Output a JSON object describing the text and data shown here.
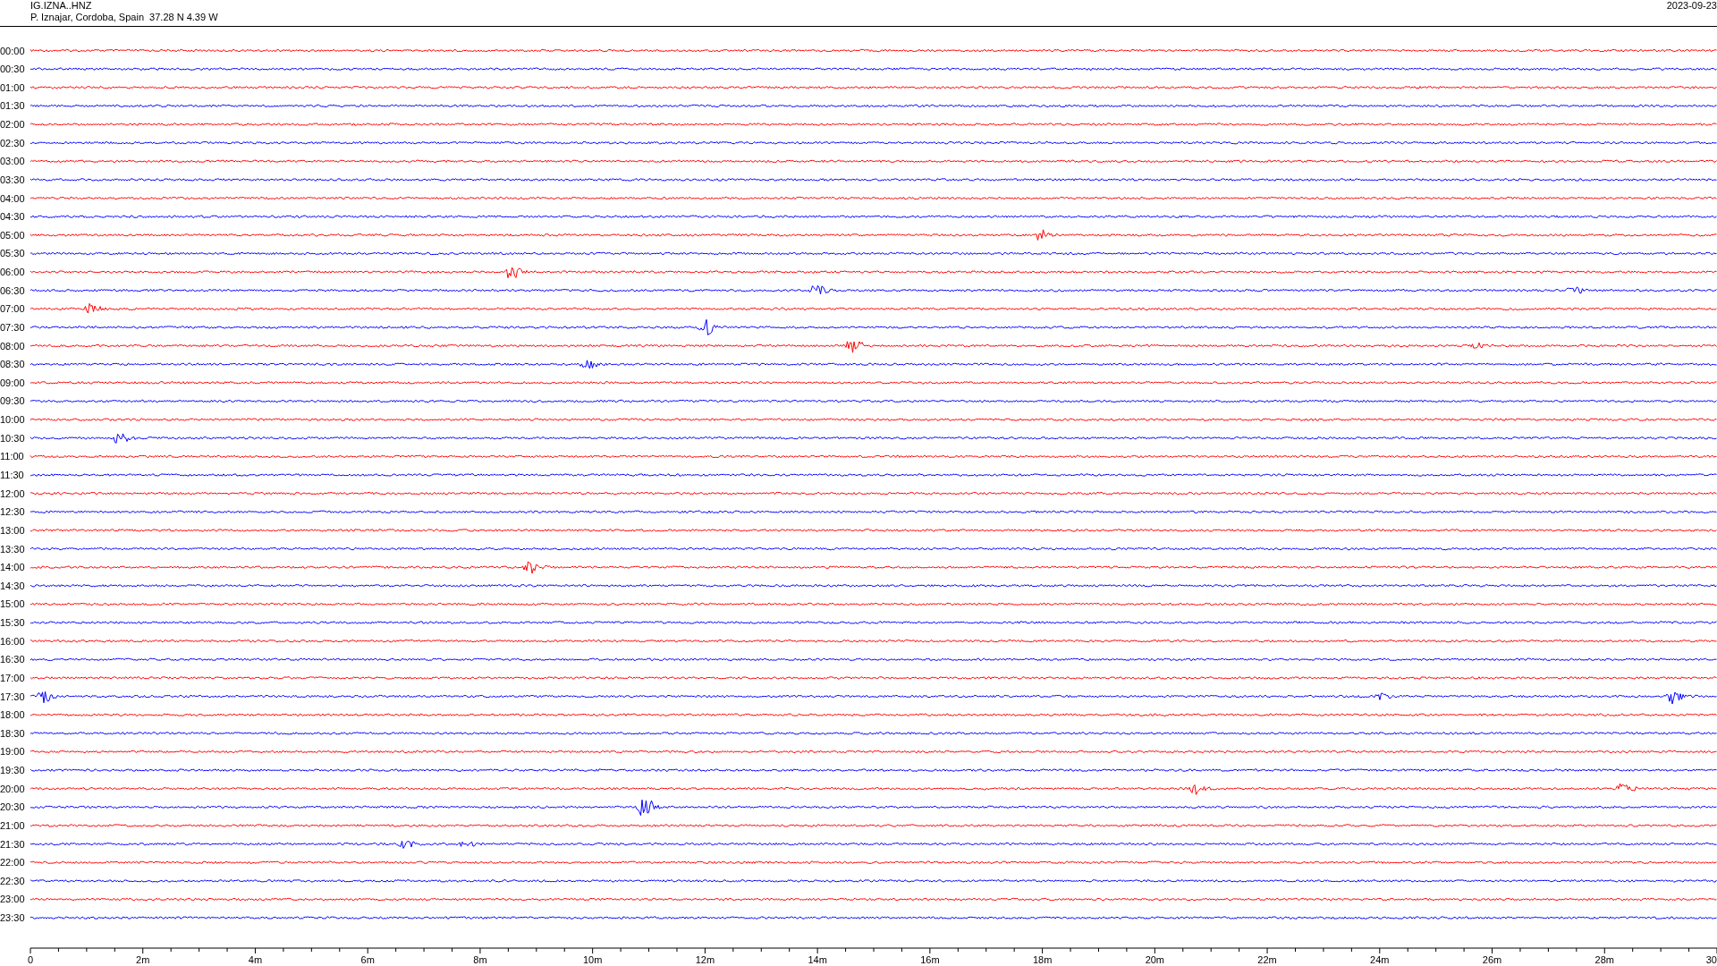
{
  "header": {
    "station": "IG.IZNA..HNZ",
    "location": "P. Iznajar, Cordoba, Spain  37.28 N 4.39 W",
    "date": "2023-09-23"
  },
  "traces": [
    {
      "label": "00:00",
      "color": "#ff0000"
    },
    {
      "label": "00:30",
      "color": "#0000ff"
    },
    {
      "label": "01:00",
      "color": "#ff0000"
    },
    {
      "label": "01:30",
      "color": "#0000ff"
    },
    {
      "label": "02:00",
      "color": "#ff0000"
    },
    {
      "label": "02:30",
      "color": "#0000ff"
    },
    {
      "label": "03:00",
      "color": "#ff0000"
    },
    {
      "label": "03:30",
      "color": "#0000ff"
    },
    {
      "label": "04:00",
      "color": "#ff0000"
    },
    {
      "label": "04:30",
      "color": "#0000ff"
    },
    {
      "label": "05:00",
      "color": "#ff0000"
    },
    {
      "label": "05:30",
      "color": "#0000ff"
    },
    {
      "label": "06:00",
      "color": "#ff0000"
    },
    {
      "label": "06:30",
      "color": "#0000ff"
    },
    {
      "label": "07:00",
      "color": "#ff0000"
    },
    {
      "label": "07:30",
      "color": "#0000ff"
    },
    {
      "label": "08:00",
      "color": "#ff0000"
    },
    {
      "label": "08:30",
      "color": "#0000ff"
    },
    {
      "label": "09:00",
      "color": "#ff0000"
    },
    {
      "label": "09:30",
      "color": "#0000ff"
    },
    {
      "label": "10:00",
      "color": "#ff0000"
    },
    {
      "label": "10:30",
      "color": "#0000ff"
    },
    {
      "label": "11:00",
      "color": "#ff0000"
    },
    {
      "label": "11:30",
      "color": "#0000ff"
    },
    {
      "label": "12:00",
      "color": "#ff0000"
    },
    {
      "label": "12:30",
      "color": "#0000ff"
    },
    {
      "label": "13:00",
      "color": "#ff0000"
    },
    {
      "label": "13:30",
      "color": "#0000ff"
    },
    {
      "label": "14:00",
      "color": "#ff0000"
    },
    {
      "label": "14:30",
      "color": "#0000ff"
    },
    {
      "label": "15:00",
      "color": "#ff0000"
    },
    {
      "label": "15:30",
      "color": "#0000ff"
    },
    {
      "label": "16:00",
      "color": "#ff0000"
    },
    {
      "label": "16:30",
      "color": "#0000ff"
    },
    {
      "label": "17:00",
      "color": "#ff0000"
    },
    {
      "label": "17:30",
      "color": "#0000ff"
    },
    {
      "label": "18:00",
      "color": "#ff0000"
    },
    {
      "label": "18:30",
      "color": "#0000ff"
    },
    {
      "label": "19:00",
      "color": "#ff0000"
    },
    {
      "label": "19:30",
      "color": "#0000ff"
    },
    {
      "label": "20:00",
      "color": "#ff0000"
    },
    {
      "label": "20:30",
      "color": "#0000ff"
    },
    {
      "label": "21:00",
      "color": "#ff0000"
    },
    {
      "label": "21:30",
      "color": "#0000ff"
    },
    {
      "label": "22:00",
      "color": "#ff0000"
    },
    {
      "label": "22:30",
      "color": "#0000ff"
    },
    {
      "label": "23:00",
      "color": "#ff0000"
    },
    {
      "label": "23:30",
      "color": "#0000ff"
    }
  ],
  "x_axis": {
    "tick_labels": [
      "0",
      "2m",
      "4m",
      "6m",
      "8m",
      "10m",
      "12m",
      "14m",
      "16m",
      "18m",
      "20m",
      "22m",
      "24m",
      "26m",
      "28m",
      "30"
    ]
  }
}
